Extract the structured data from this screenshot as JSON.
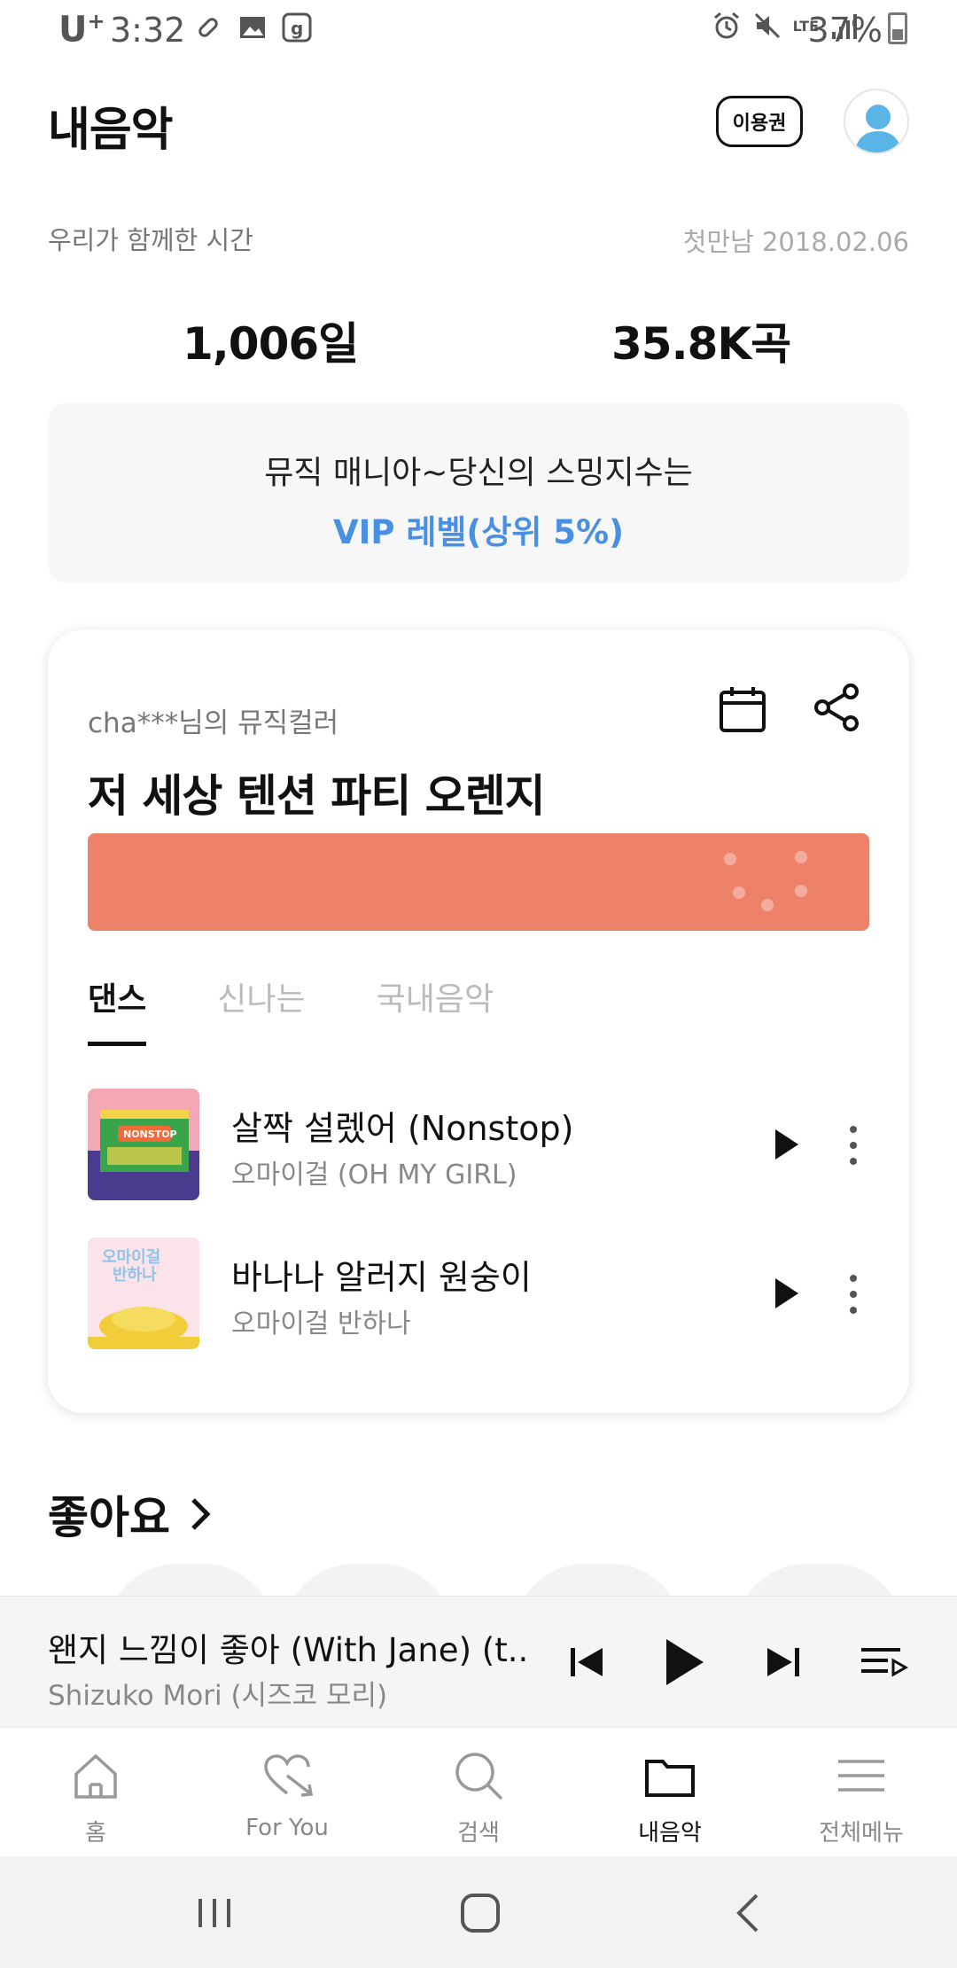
{
  "status_bar": {
    "carrier": "U",
    "carrier_sup": "+",
    "time": "3:32",
    "network": "LTE",
    "battery": "37%"
  },
  "header": {
    "title": "내음악",
    "pass_button": "이용권"
  },
  "together": {
    "label": "우리가 함께한 시간",
    "first_meet": "첫만남 2018.02.06",
    "days": "1,006일",
    "songs": "35.8K곡"
  },
  "mania": {
    "line1": "뮤직 매니아~당신의 스밍지수는",
    "line2": "VIP 레벨(상위 5%)"
  },
  "music_color": {
    "user_label": "cha***님의 뮤직컬러",
    "title": "저 세상 텐션 파티 오렌지",
    "bar_color": "#ee8169",
    "tabs": [
      {
        "label": "댄스",
        "active": true
      },
      {
        "label": "신나는",
        "active": false
      },
      {
        "label": "국내음악",
        "active": false
      }
    ],
    "songs": [
      {
        "title": "살짝 설렜어 (Nonstop)",
        "artist": "오마이걸 (OH MY GIRL)"
      },
      {
        "title": "바나나 알러지 원숭이",
        "artist": "오마이걸 반하나"
      }
    ]
  },
  "likes": {
    "title": "좋아요"
  },
  "mini_player": {
    "title": "왠지 느낌이 좋아 (With Jane) (t..",
    "artist": "Shizuko Mori (시즈코 모리)"
  },
  "bottom_nav": [
    {
      "label": "홈",
      "icon": "home-icon",
      "active": false
    },
    {
      "label": "For You",
      "icon": "heart-arrow-icon",
      "active": false
    },
    {
      "label": "검색",
      "icon": "search-icon",
      "active": false
    },
    {
      "label": "내음악",
      "icon": "folder-icon",
      "active": true
    },
    {
      "label": "전체메뉴",
      "icon": "menu-icon",
      "active": false
    }
  ],
  "colors": {
    "accent_blue": "#4a90e2",
    "color_bar": "#ee8169"
  }
}
